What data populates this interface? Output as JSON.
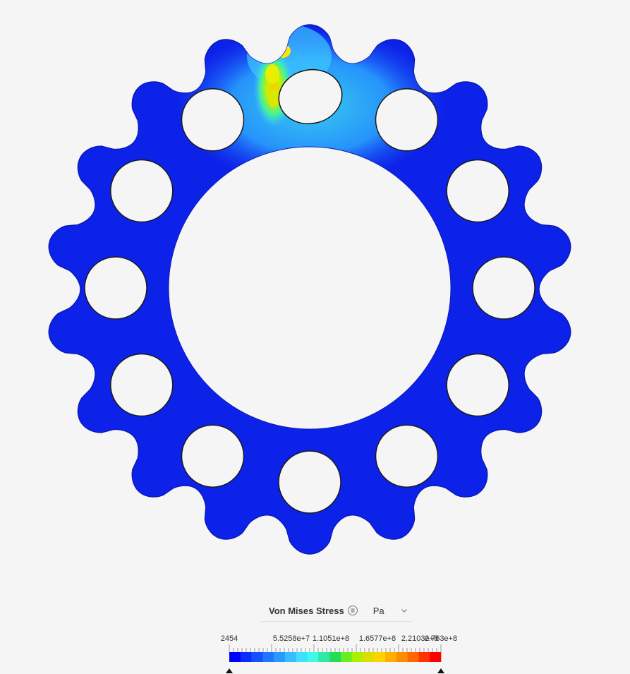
{
  "legend": {
    "title": "Von Mises Stress",
    "unit": "Pa",
    "labels": [
      "2454",
      "5.5258e+7",
      "1.1051e+8",
      "1.6577e+8",
      "2.2103e+8",
      "2.763e+8"
    ],
    "colors": [
      "#0000ff",
      "#0a2cff",
      "#1550ff",
      "#1f76ff",
      "#2a99ff",
      "#35bdff",
      "#3fdfff",
      "#3ff8e8",
      "#2ee8a8",
      "#22dd55",
      "#66ee22",
      "#aaf000",
      "#dddd00",
      "#ffd200",
      "#ffb000",
      "#ff8c00",
      "#ff6600",
      "#ff3300",
      "#ff0000"
    ]
  },
  "model": {
    "base_color": "#0d22e8",
    "outline_color": "#0a1ab8",
    "hole_outline": "#1a1a1a"
  }
}
